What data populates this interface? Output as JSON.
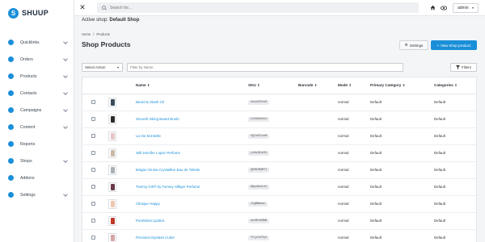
{
  "brand": {
    "name": "SHUUP",
    "mark": "S"
  },
  "sidebar": {
    "items": [
      {
        "label": "Quicklinks",
        "icon": "link-icon",
        "has_children": true
      },
      {
        "label": "Orders",
        "icon": "cart-icon",
        "has_children": true
      },
      {
        "label": "Products",
        "icon": "cube-icon",
        "has_children": true
      },
      {
        "label": "Contacts",
        "icon": "users-icon",
        "has_children": true
      },
      {
        "label": "Campaigns",
        "icon": "megaphone-icon",
        "has_children": true
      },
      {
        "label": "Content",
        "icon": "file-icon",
        "has_children": true
      },
      {
        "label": "Reports",
        "icon": "chart-icon",
        "has_children": false
      },
      {
        "label": "Shops",
        "icon": "store-icon",
        "has_children": true
      },
      {
        "label": "Addons",
        "icon": "puzzle-icon",
        "has_children": false
      },
      {
        "label": "Settings",
        "icon": "gear-icon",
        "has_children": true
      }
    ]
  },
  "topbar": {
    "search_placeholder": "Search for...",
    "user_label": "admin"
  },
  "context": {
    "active_shop_prefix": "Active shop:",
    "active_shop_name": "Default Shop"
  },
  "breadcrumb": {
    "home": "Home",
    "separator": "/",
    "current": "Products"
  },
  "page": {
    "title": "Shop Products"
  },
  "actions": {
    "settings_label": "Settings",
    "new_label": "New shop product"
  },
  "filters": {
    "bulk_action_label": "Select Action",
    "name_placeholder": "Filter by Name",
    "filters_label": "Filters"
  },
  "table": {
    "columns": [
      "Name",
      "SKU",
      "Barcode",
      "Mode",
      "Primary Category",
      "Categories"
    ],
    "sort_glyph": "⬍",
    "rows": [
      {
        "name": "Beard & Stash Oil",
        "sku": "khvuKIPnoK",
        "barcode": "",
        "mode": "normal",
        "primary_category": "Default",
        "categories": "Default",
        "thumb_color": "#3b4a5a"
      },
      {
        "name": "Smooth Inking Beard Brush",
        "sku": "kJzSkWtAiv",
        "barcode": "",
        "mode": "normal",
        "primary_category": "Default",
        "categories": "Default",
        "thumb_color": "#2b2b2b"
      },
      {
        "name": "La Vie Est Belle",
        "sku": "dQCsKZtxeM",
        "barcode": "",
        "mode": "normal",
        "primary_category": "Default",
        "categories": "Default",
        "thumb_color": "#e9c5c8"
      },
      {
        "name": "Still Jennifer Lopez Perfume",
        "sku": "yiAmjBinOk",
        "barcode": "",
        "mode": "normal",
        "primary_category": "Default",
        "categories": "Default",
        "thumb_color": "#c9b8a6"
      },
      {
        "name": "Bvlgari Omnia Crystalline Eau de Toilette",
        "sku": "QEHKZNWMTI",
        "barcode": "",
        "mode": "normal",
        "primary_category": "Default",
        "categories": "Default",
        "thumb_color": "#a9b0b8"
      },
      {
        "name": "Tommy Girl® by Tommy Hilfiger Perfume",
        "sku": "AWyeAkmlJe",
        "barcode": "",
        "mode": "normal",
        "primary_category": "Default",
        "categories": "Default",
        "thumb_color": "#6b3a4a"
      },
      {
        "name": "Clinique Happy",
        "sku": "sCgBWmoac",
        "barcode": "",
        "mode": "normal",
        "primary_category": "Default",
        "categories": "Default",
        "thumb_color": "#f0c7b0"
      },
      {
        "name": "PureMoist Lipstick",
        "sku": "aecBtHdMWB",
        "barcode": "",
        "mode": "normal",
        "primary_category": "Default",
        "categories": "Default",
        "thumb_color": "#c0392b"
      },
      {
        "name": "Precision Eyelash Curler",
        "sku": "YfLpIoFDyk",
        "barcode": "",
        "mode": "normal",
        "primary_category": "Default",
        "categories": "Default",
        "thumb_color": "#d4a5a5"
      }
    ]
  },
  "colors": {
    "accent": "#1a8fd8",
    "sidebar_bg": "#ffffff",
    "page_bg": "#f4f5f7"
  }
}
